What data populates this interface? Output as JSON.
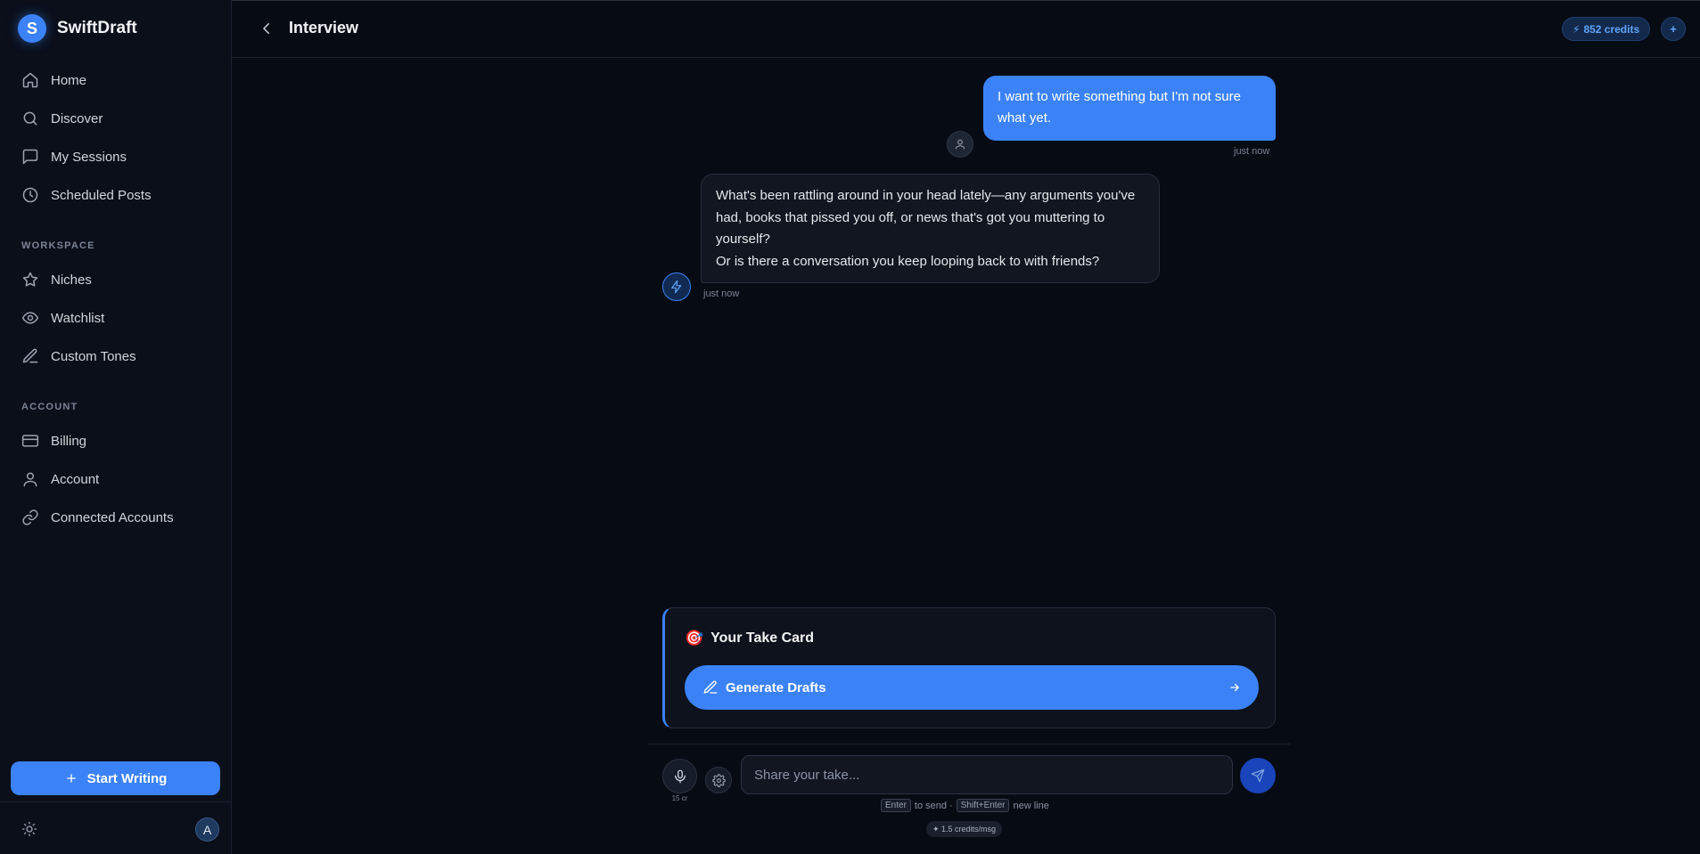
{
  "app": {
    "name": "SwiftDraft",
    "logo_letter": "S"
  },
  "sidebar": {
    "items": [
      {
        "label": "Home",
        "icon": "home-icon"
      },
      {
        "label": "Discover",
        "icon": "search-icon"
      },
      {
        "label": "My Sessions",
        "icon": "message-icon"
      },
      {
        "label": "Scheduled Posts",
        "icon": "clock-icon"
      }
    ],
    "workspace_label": "WORKSPACE",
    "workspace_items": [
      {
        "label": "Niches",
        "icon": "star-icon"
      },
      {
        "label": "Watchlist",
        "icon": "eye-icon"
      },
      {
        "label": "Custom Tones",
        "icon": "pen-icon"
      }
    ],
    "account_label": "ACCOUNT",
    "account_items": [
      {
        "label": "Billing",
        "icon": "card-icon"
      },
      {
        "label": "Account",
        "icon": "user-icon"
      },
      {
        "label": "Connected Accounts",
        "icon": "link-icon"
      }
    ],
    "start_writing_label": "Start Writing",
    "avatar_letter": "A"
  },
  "header": {
    "title": "Interview",
    "credits": "852 credits",
    "add_credits": "+"
  },
  "chat": {
    "user_message": "I want to write something but I'm not sure what yet.",
    "user_time": "just now",
    "ai_message_line1": "What's been rattling around in your head lately—any arguments you've had, books that pissed you off, or news that's got you muttering to yourself?",
    "ai_message_line2": "Or is there a conversation you keep looping back to with friends?",
    "ai_time": "just now"
  },
  "take_card": {
    "emoji": "🎯",
    "title": "Your Take Card",
    "generate_label": "Generate Drafts"
  },
  "composer": {
    "placeholder": "Share your take...",
    "mic_cost": "15 cr",
    "hint_enter": "Enter",
    "hint_send": "to send ·",
    "hint_shift_enter": "Shift+Enter",
    "hint_newline": "new line",
    "rate": "✦ 1.5 credits/msg"
  },
  "colors": {
    "accent": "#3b82f6",
    "background": "#070b14",
    "sidebar": "#0a0f1a"
  }
}
